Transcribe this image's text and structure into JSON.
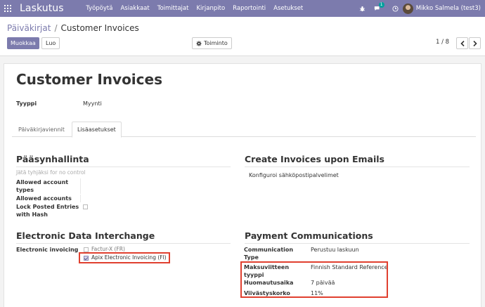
{
  "navbar": {
    "brand": "Laskutus",
    "menu": [
      "Työpöytä",
      "Asiakkaat",
      "Toimittajat",
      "Kirjanpito",
      "Raportointi",
      "Asetukset"
    ],
    "chat_badge": "1",
    "user": "Mikko Salmela (test3)",
    "color": "#7c7bad"
  },
  "control": {
    "breadcrumb_parent": "Päiväkirjat",
    "breadcrumb_separator": "/",
    "breadcrumb_current": "Customer Invoices",
    "edit_label": "Muokkaa",
    "create_label": "Luo",
    "action_label": "Toiminto",
    "pager_text": "1 / 8"
  },
  "form": {
    "title": "Customer Invoices",
    "type_label": "Tyyppi",
    "type_value": "Myynti",
    "tabs": [
      "Päiväkirjaviennit",
      "Lisäasetukset"
    ],
    "access": {
      "heading": "Pääsynhallinta",
      "hint": "Jätä tyhjäksi for no control",
      "allowed_types_label": "Allowed account types",
      "allowed_accounts_label": "Allowed accounts",
      "lock_label": "Lock Posted Entries with Hash"
    },
    "email": {
      "heading": "Create Invoices upon Emails",
      "configure": "Konfiguroi sähköpostipalvelimet"
    },
    "edi": {
      "heading": "Electronic Data Interchange",
      "label": "Electronic invoicing",
      "options": [
        {
          "label": "Factur-X (FR)",
          "checked": false
        },
        {
          "label": "Apix Electronic Invoicing (FI)",
          "checked": true
        }
      ]
    },
    "payment": {
      "heading": "Payment Communications",
      "comm_type_label": "Communication Type",
      "comm_type_value": "Perustuu laskuun",
      "ref_label": "Maksuviitteen tyyppi",
      "ref_value": "Finnish Standard Reference",
      "notice_label": "Huomautusaika",
      "notice_value": "7 päivää",
      "interest_label": "Viivästyskorko",
      "interest_value": "11%"
    }
  },
  "highlight_color": "#e0402f"
}
